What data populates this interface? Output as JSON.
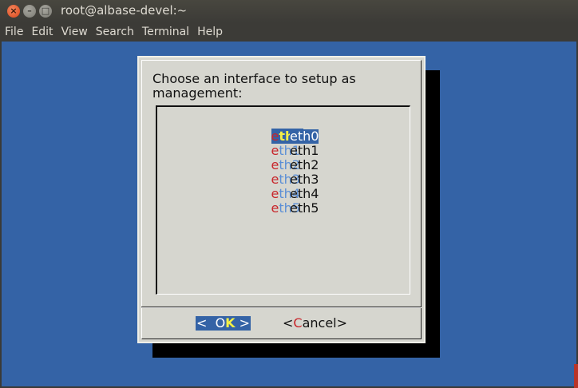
{
  "window": {
    "title": "root@albase-devel:~",
    "close_glyph": "×",
    "minimize_glyph": "–",
    "maximize_glyph": "□"
  },
  "menubar": {
    "items": [
      "File",
      "Edit",
      "View",
      "Search",
      "Terminal",
      "Help"
    ]
  },
  "dialog": {
    "prompt_line1": "Choose an interface to setup as",
    "prompt_line2": "management:",
    "items": [
      {
        "tag_hotkey": "e",
        "tag_rest": "th0",
        "item": "eth0",
        "selected": true
      },
      {
        "tag_hotkey": "e",
        "tag_rest": "th1",
        "item": "eth1",
        "selected": false
      },
      {
        "tag_hotkey": "e",
        "tag_rest": "th2",
        "item": "eth2",
        "selected": false
      },
      {
        "tag_hotkey": "e",
        "tag_rest": "th3",
        "item": "eth3",
        "selected": false
      },
      {
        "tag_hotkey": "e",
        "tag_rest": "th4",
        "item": "eth4",
        "selected": false
      },
      {
        "tag_hotkey": "e",
        "tag_rest": "th5",
        "item": "eth5",
        "selected": false
      }
    ],
    "ok_button": {
      "left": "<  ",
      "pre": "O",
      "hotkey": "K",
      "right": " >"
    },
    "cancel_button": {
      "left": "<",
      "hotkey": "C",
      "rest": "ancel>"
    }
  },
  "colors": {
    "terminal_bg": "#3463a6",
    "dialog_bg": "#d6d6cf",
    "hotkey_red": "#c8262b",
    "highlight_yellow": "#f4f046",
    "tag_blue": "#5b8fd6"
  }
}
